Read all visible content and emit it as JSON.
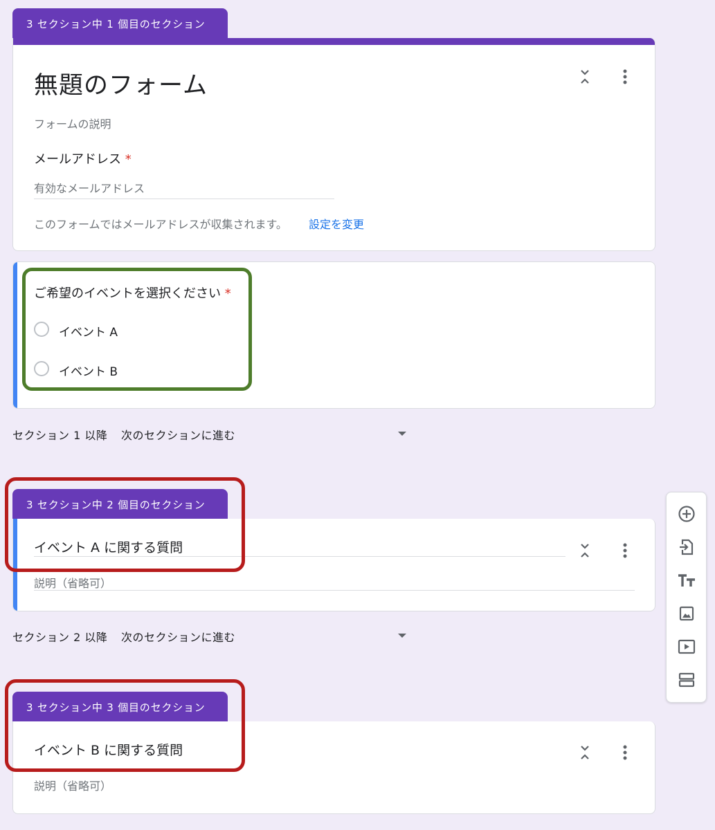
{
  "section1": {
    "tab": "3 セクション中 1 個目のセクション",
    "title": "無題のフォーム",
    "description_placeholder": "フォームの説明",
    "email_label": "メールアドレス",
    "required_mark": "*",
    "email_placeholder": "有効なメールアドレス",
    "collect_notice": "このフォームではメールアドレスが収集されます。",
    "change_settings": "設定を変更"
  },
  "question": {
    "title": "ご希望のイベントを選択ください",
    "required_mark": "*",
    "options": [
      "イベント A",
      "イベント B"
    ]
  },
  "after_section1": {
    "label": "セクション 1 以降",
    "value": "次のセクションに進む"
  },
  "section2": {
    "tab": "3 セクション中 2 個目のセクション",
    "title": "イベント A に関する質問",
    "description_placeholder": "説明（省略可）"
  },
  "after_section2": {
    "label": "セクション 2 以降",
    "value": "次のセクションに進む"
  },
  "section3": {
    "tab": "3 セクション中 3 個目のセクション",
    "title": "イベント B に関する質問",
    "description_placeholder": "説明（省略可）"
  },
  "toolbar": {
    "icons": [
      "add-question-icon",
      "import-questions-icon",
      "add-title-icon",
      "add-image-icon",
      "add-video-icon",
      "add-section-icon"
    ]
  },
  "colors": {
    "theme": "#673ab7",
    "focus_bar": "#4285f4",
    "link": "#1a73e8",
    "required": "#d93025",
    "highlight_green": "#4e7d2b",
    "highlight_red": "#b71c1c"
  }
}
